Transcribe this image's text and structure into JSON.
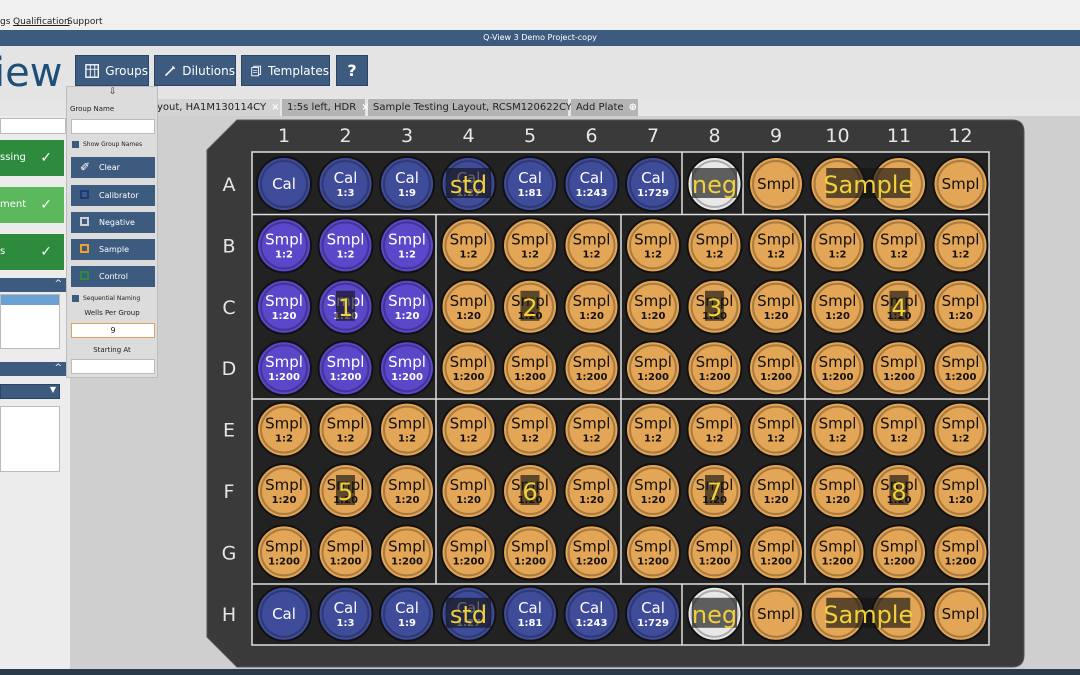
{
  "menu": {
    "items": [
      "gs",
      "Qualification",
      "Support"
    ]
  },
  "window_title": "Q-View 3 Demo Project-copy",
  "logo_text": "iew",
  "toolbar": {
    "groups": "Groups",
    "dilutions": "Dilutions",
    "templates": "Templates",
    "help": "?"
  },
  "tabs": [
    {
      "label": "yout, HA1M130114CY",
      "close": "×"
    },
    {
      "label": "1:5s left, HDR",
      "close": "×"
    },
    {
      "label": "Sample Testing Layout, RCSM120622CY",
      "close": "×"
    },
    {
      "label": "Add Plate",
      "close": ""
    }
  ],
  "workflow": [
    {
      "label": "ssing",
      "check": "✓",
      "color": "#2e8b3e"
    },
    {
      "label": "ment",
      "check": "✓",
      "color": "#5cb85c"
    },
    {
      "label": "s",
      "check": "✓",
      "color": "#2e8b3e"
    }
  ],
  "groups_panel": {
    "group_name_label": "Group Name",
    "group_name_value": "",
    "show_group_names": "Show Group Names",
    "buttons": [
      {
        "label": "Clear",
        "color": "#ffffff"
      },
      {
        "label": "Calibrator",
        "color": "#1e3a78"
      },
      {
        "label": "Negative",
        "color": "#cfcfcf"
      },
      {
        "label": "Sample",
        "color": "#f0a030"
      },
      {
        "label": "Control",
        "color": "#2e8b3e"
      }
    ],
    "sequential_naming": "Sequential Naming",
    "wells_per_group_label": "Wells Per Group",
    "wells_per_group_value": "9",
    "starting_at_label": "Starting At",
    "starting_at_value": ""
  },
  "plate": {
    "columns": [
      "1",
      "2",
      "3",
      "4",
      "5",
      "6",
      "7",
      "8",
      "9",
      "10",
      "11",
      "12"
    ],
    "rows": [
      "A",
      "B",
      "C",
      "D",
      "E",
      "F",
      "G",
      "H"
    ],
    "colors": {
      "purple": "#5a47c9",
      "navy": "#3f4c9a",
      "orange": "#e3a556",
      "white": "#e8e8e8",
      "label_yellow": "#f2d03a"
    },
    "row_A": [
      {
        "t": "Cal",
        "s": "",
        "c": "navy"
      },
      {
        "t": "Cal",
        "s": "1:3",
        "c": "navy"
      },
      {
        "t": "Cal",
        "s": "1:9",
        "c": "navy"
      },
      {
        "t": "Cal",
        "s": "1:27",
        "c": "navy"
      },
      {
        "t": "Cal",
        "s": "1:81",
        "c": "navy"
      },
      {
        "t": "Cal",
        "s": "1:243",
        "c": "navy"
      },
      {
        "t": "Cal",
        "s": "1:729",
        "c": "navy"
      },
      {
        "t": "",
        "s": "",
        "c": "white"
      },
      {
        "t": "Smpl",
        "s": "",
        "c": "orange"
      },
      {
        "t": "",
        "s": "",
        "c": "orange"
      },
      {
        "t": "",
        "s": "",
        "c": "orange"
      },
      {
        "t": "Smpl",
        "s": "",
        "c": "orange"
      }
    ],
    "row_H": [
      {
        "t": "Cal",
        "s": "",
        "c": "navy"
      },
      {
        "t": "Cal",
        "s": "1:3",
        "c": "navy"
      },
      {
        "t": "Cal",
        "s": "1:9",
        "c": "navy"
      },
      {
        "t": "Cal",
        "s": "1:27",
        "c": "navy"
      },
      {
        "t": "Cal",
        "s": "1:81",
        "c": "navy"
      },
      {
        "t": "Cal",
        "s": "1:243",
        "c": "navy"
      },
      {
        "t": "Cal",
        "s": "1:729",
        "c": "navy"
      },
      {
        "t": "",
        "s": "",
        "c": "white"
      },
      {
        "t": "Smpl",
        "s": "",
        "c": "orange"
      },
      {
        "t": "",
        "s": "",
        "c": "orange"
      },
      {
        "t": "",
        "s": "",
        "c": "orange"
      },
      {
        "t": "Smpl",
        "s": "",
        "c": "orange"
      }
    ],
    "sample_text": "Smpl",
    "dilution_rows": {
      "B": "1:2",
      "C": "1:20",
      "D": "1:200",
      "E": "1:2",
      "F": "1:20",
      "G": "1:200"
    },
    "group_labels": [
      {
        "text": "std",
        "row": "A",
        "col": 4
      },
      {
        "text": "neg",
        "row": "A",
        "col": 8
      },
      {
        "text": "Sample",
        "row": "A",
        "col": 10.5
      },
      {
        "text": "1",
        "row": "C",
        "col": 2
      },
      {
        "text": "2",
        "row": "C",
        "col": 5
      },
      {
        "text": "3",
        "row": "C",
        "col": 8
      },
      {
        "text": "4",
        "row": "C",
        "col": 11
      },
      {
        "text": "5",
        "row": "F",
        "col": 2
      },
      {
        "text": "6",
        "row": "F",
        "col": 5
      },
      {
        "text": "7",
        "row": "F",
        "col": 8
      },
      {
        "text": "8",
        "row": "F",
        "col": 11
      },
      {
        "text": "std",
        "row": "H",
        "col": 4
      },
      {
        "text": "neg",
        "row": "H",
        "col": 8
      },
      {
        "text": "Sample",
        "row": "H",
        "col": 10.5
      }
    ]
  }
}
